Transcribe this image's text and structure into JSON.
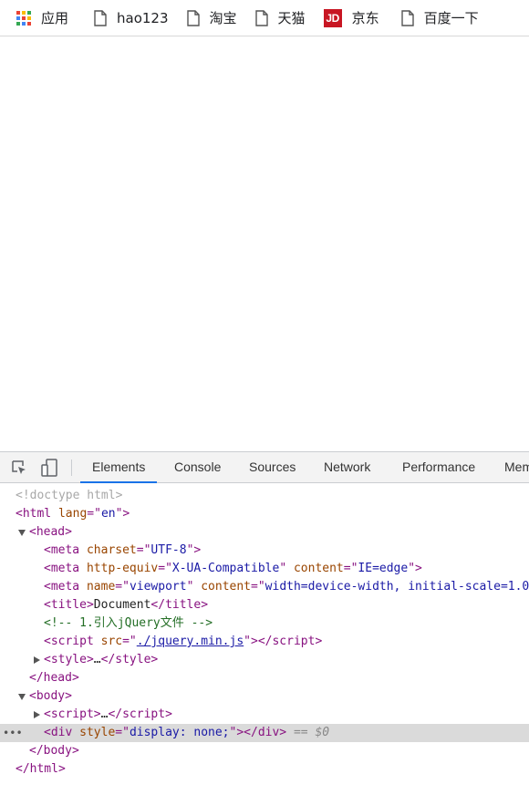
{
  "bookmarks": [
    {
      "label": "应用",
      "icon": "apps-grid-icon"
    },
    {
      "label": "hao123",
      "icon": "page-icon"
    },
    {
      "label": "淘宝",
      "icon": "page-icon"
    },
    {
      "label": "天猫",
      "icon": "page-icon"
    },
    {
      "label": "京东",
      "icon": "jd-logo-icon",
      "logo_text": "JD"
    },
    {
      "label": "百度一下",
      "icon": "page-icon"
    }
  ],
  "devtools": {
    "tabs": [
      "Elements",
      "Console",
      "Sources",
      "Network",
      "Performance",
      "Mem"
    ],
    "active_tab": "Elements",
    "accent_color": "#1a73e8"
  },
  "dom": {
    "doctype": "<!doctype html>",
    "html_open": {
      "tag": "html",
      "attr": "lang",
      "value": "en"
    },
    "head": "head",
    "meta1": {
      "attr": "charset",
      "value": "UTF-8"
    },
    "meta2": {
      "attr1": "http-equiv",
      "value1": "X-UA-Compatible",
      "attr2": "content",
      "value2": "IE=edge"
    },
    "meta3": {
      "attr1": "name",
      "value1": "viewport",
      "attr2": "content",
      "value2": "width=device-width, initial-scale=1.0"
    },
    "title_text": "Document",
    "comment": "<!-- 1.引入jQuery文件 -->",
    "script_src": "./jquery.min.js",
    "style_collapsed": "…",
    "body": "body",
    "script_collapsed": "…",
    "div_style": "display: none;",
    "selected_suffix": "== $0"
  }
}
